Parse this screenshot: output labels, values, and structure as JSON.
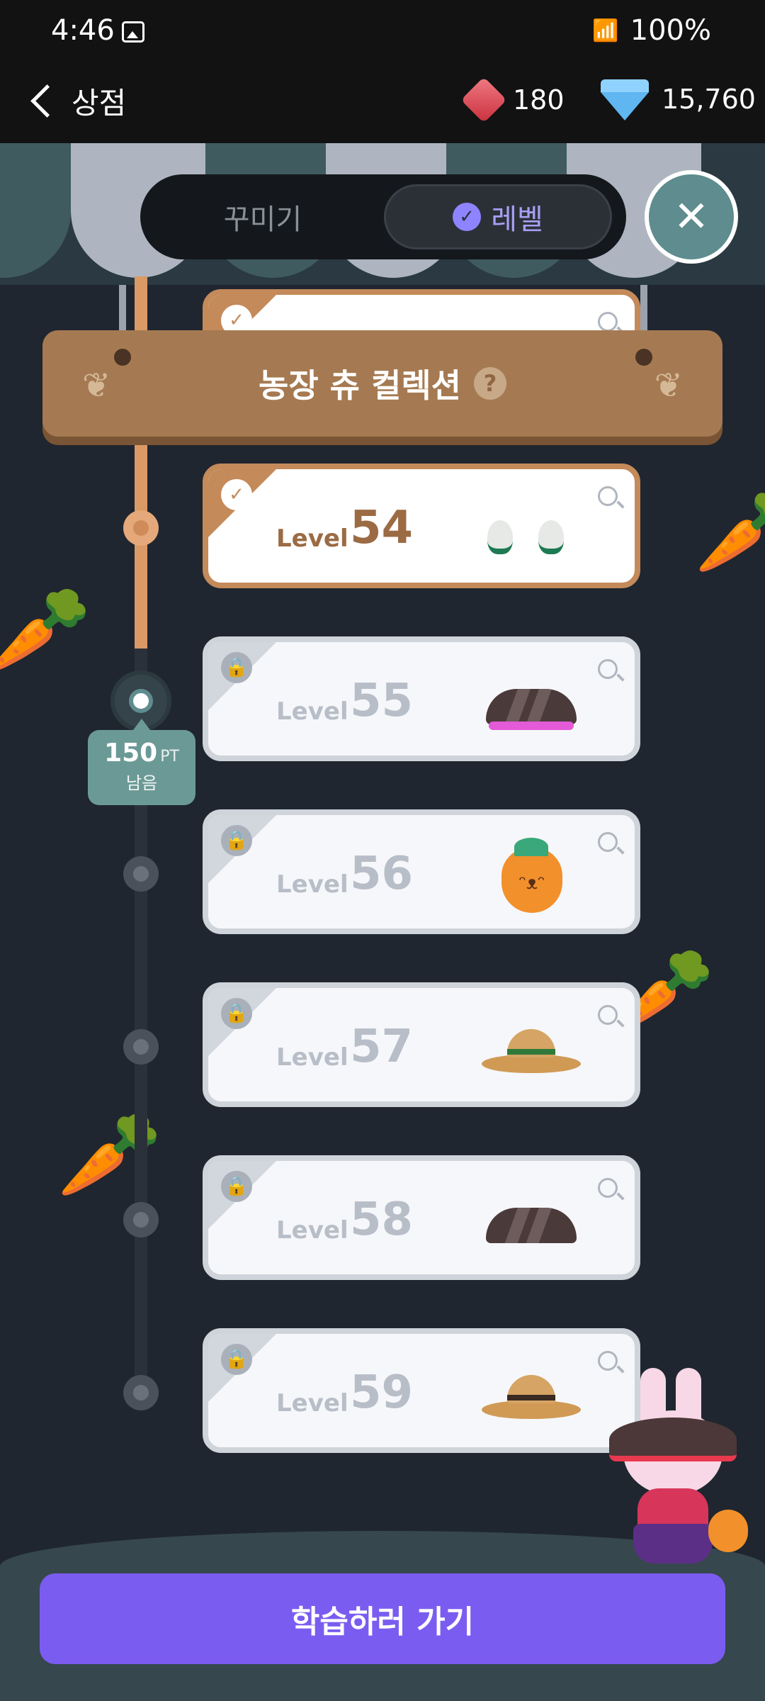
{
  "status_bar": {
    "time": "4:46",
    "battery": "100%",
    "icons": [
      "image-icon",
      "wifi-icon",
      "signal-icon"
    ]
  },
  "header": {
    "back_label": "상점",
    "ruby_count": "180",
    "diamond_count": "15,760"
  },
  "tabs": {
    "decorate_label": "꾸미기",
    "level_label": "레벨",
    "selected": "레벨"
  },
  "banner": {
    "title": "농장 츄 컬렉션"
  },
  "progress": {
    "points": "150",
    "unit": "PT",
    "remaining_label": "남음"
  },
  "levels": [
    {
      "word": "Level",
      "number": "54",
      "status": "completed",
      "reward": "earrings"
    },
    {
      "word": "Level",
      "number": "55",
      "status": "locked",
      "reward": "pink-visor"
    },
    {
      "word": "Level",
      "number": "56",
      "status": "locked",
      "reward": "carrot-charm"
    },
    {
      "word": "Level",
      "number": "57",
      "status": "locked",
      "reward": "straw-hat-green"
    },
    {
      "word": "Level",
      "number": "58",
      "status": "locked",
      "reward": "brown-visor"
    },
    {
      "word": "Level",
      "number": "59",
      "status": "locked",
      "reward": "straw-hat-brown"
    }
  ],
  "cta": {
    "label": "학습하러 가기"
  },
  "colors": {
    "accent": "#7b5cf0",
    "completed": "#c48a5a",
    "locked": "#cfd4db",
    "teal": "#5e8c8f"
  }
}
